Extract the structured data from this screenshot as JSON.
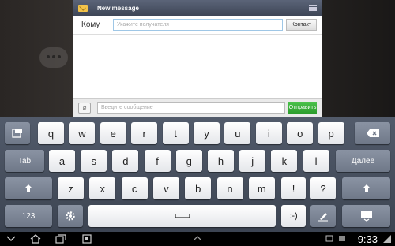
{
  "dialog": {
    "title": "New message",
    "to_label": "Кому",
    "to_placeholder": "Укажите получателя",
    "contact_button": "Контакт",
    "message_placeholder": "Введите сообщение",
    "send_button": "Отправить"
  },
  "keyboard": {
    "row1": [
      "q",
      "w",
      "e",
      "r",
      "t",
      "y",
      "u",
      "i",
      "o",
      "p"
    ],
    "row2": [
      "a",
      "s",
      "d",
      "f",
      "g",
      "h",
      "j",
      "k",
      "l"
    ],
    "row3": [
      "z",
      "x",
      "c",
      "v",
      "b",
      "n",
      "m"
    ],
    "tab_label": "Tab",
    "enter_label": "Далее",
    "num_label": "123",
    "smiley_label": ":-)",
    "excl_label": "!",
    "excl_sub": ",",
    "quest_label": "?",
    "quest_sub": "."
  },
  "status": {
    "time": "9:33"
  },
  "icons": {
    "title": "envelope-icon",
    "menu": "menu-icon",
    "attach": "paperclip-icon",
    "backspace": "backspace-icon",
    "shift": "shift-icon",
    "settings": "gear-icon",
    "space": "space-icon",
    "handwriting": "pen-icon",
    "hide": "keyboard-hide-icon"
  },
  "colors": {
    "title_bar": "#4a5366",
    "send_green": "#2fa52f",
    "keyboard_bg": "#4a5361"
  }
}
